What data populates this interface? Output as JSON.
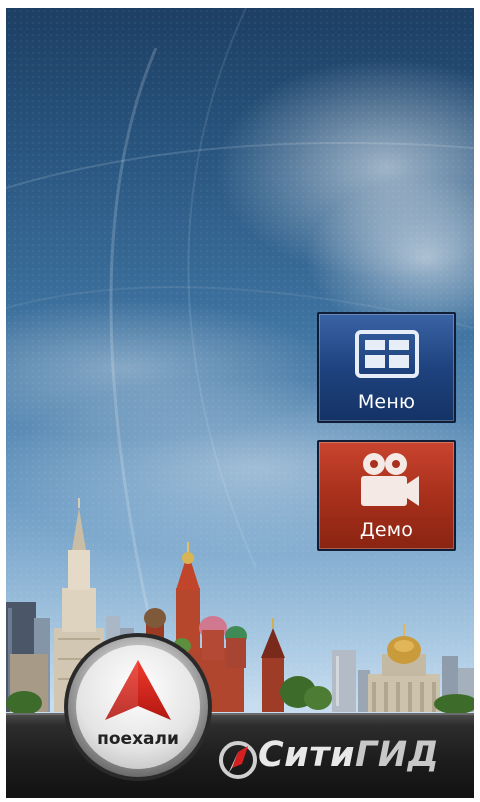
{
  "app": {
    "name": "СитиГИД",
    "logo_part1": "Сити",
    "logo_part2": "ГИД"
  },
  "buttons": {
    "menu_label": "Меню",
    "demo_label": "Демо",
    "go_label": "поехали"
  },
  "colors": {
    "menu_button": "#1f437f",
    "demo_button": "#a8301c",
    "go_arrow": "#d42020",
    "bottom_bar": "#1c1c1c"
  },
  "icons": {
    "menu": "menu-grid-icon",
    "demo": "video-camera-icon",
    "go": "navigation-arrow-icon",
    "logo": "compass-icon"
  }
}
